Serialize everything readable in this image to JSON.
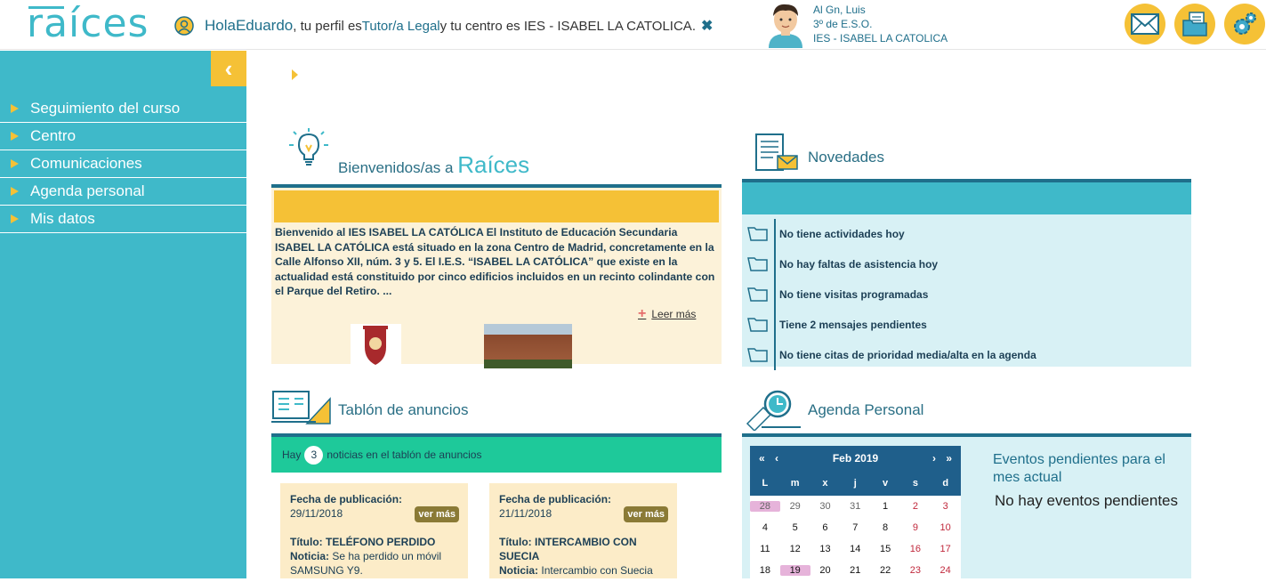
{
  "header": {
    "logo": "raíces",
    "greeting_prefix": "Hola ",
    "user_name": "Eduardo",
    "greeting_mid1": " , tu perfil es ",
    "profile": "Tutor/a Legal",
    "greeting_mid2": " y tu centro es IES - ISABEL LA CATOLICA.",
    "close_glyph": "✖"
  },
  "student": {
    "name": "Al Gn, Luis",
    "course": "3º de E.S.O.",
    "center": "IES - ISABEL LA CATOLICA"
  },
  "header_buttons": [
    "mail-icon",
    "documents-icon",
    "settings-icon"
  ],
  "sidebar": {
    "collapse_glyph": "‹",
    "items": [
      {
        "label": "Seguimiento del curso"
      },
      {
        "label": "Centro"
      },
      {
        "label": "Comunicaciones"
      },
      {
        "label": "Agenda personal"
      },
      {
        "label": "Mis datos"
      }
    ]
  },
  "welcome": {
    "title_prefix": "Bienvenidos/as a ",
    "title_brand": "Raíces",
    "text": "Bienvenido al IES ISABEL LA CATÓLICA El Instituto de Educación Secundaria ISABEL LA CATÓLICA está situado en la zona Centro de Madrid, concretamente en la Calle Alfonso XII, núm. 3 y 5. El I.E.S. “ISABEL LA CATÓLICA” que existe en la actualidad está constituido por cinco edificios incluidos en un recinto colindante con el Parque del Retiro. ...",
    "read_more": "Leer más",
    "plus": "+"
  },
  "news": {
    "title": "Novedades",
    "items": [
      "No tiene actividades hoy",
      "No hay faltas de asistencia hoy",
      "No tiene visitas programadas",
      "Tiene 2 mensajes pendientes",
      "No tiene citas de prioridad media/alta en la agenda"
    ]
  },
  "board": {
    "title": "Tablón de anuncios",
    "prefix": "Hay",
    "count": "3",
    "suffix": "noticias en el tablón de anuncios",
    "cards": [
      {
        "date_label": "Fecha de publicación:",
        "date": "29/11/2018",
        "more": "ver más",
        "title_label": "Título:",
        "title": "TELÉFONO PERDIDO",
        "note_label": "Noticia:",
        "note": "Se ha perdido un móvil SAMSUNG Y9."
      },
      {
        "date_label": "Fecha de publicación:",
        "date": "21/11/2018",
        "more": "ver más",
        "title_label": "Título:",
        "title": "INTERCAMBIO CON SUECIA",
        "note_label": "Noticia:",
        "note": "Intercambio con Suecia"
      }
    ]
  },
  "agenda": {
    "title": "Agenda Personal",
    "month": "Feb 2019",
    "nav_first": "«",
    "nav_prev": "‹",
    "nav_next": "›",
    "nav_last": "»",
    "days": [
      "L",
      "m",
      "x",
      "j",
      "v",
      "s",
      "d"
    ],
    "weeks": [
      [
        "28",
        "29",
        "30",
        "31",
        "1",
        "2",
        "3"
      ],
      [
        "4",
        "5",
        "6",
        "7",
        "8",
        "9",
        "10"
      ],
      [
        "11",
        "12",
        "13",
        "14",
        "15",
        "16",
        "17"
      ],
      [
        "18",
        "19",
        "20",
        "21",
        "22",
        "23",
        "24"
      ]
    ],
    "events_title": "Eventos pendientes para el mes actual",
    "events_none": "No hay eventos pendientes"
  },
  "colors": {
    "teal": "#3fb9c9",
    "yellow": "#f5c136",
    "navy": "#1f6f8b",
    "green": "#1ec99a"
  }
}
